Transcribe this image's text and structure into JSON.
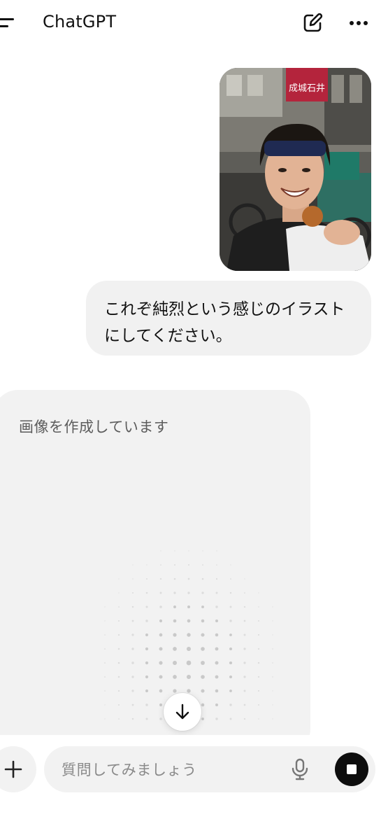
{
  "header": {
    "title": "ChatGPT",
    "menu_icon": "menu-icon",
    "compose_icon": "new-chat-icon",
    "more_icon": "more-horizontal-icon"
  },
  "conversation": {
    "user_image": {
      "alt": "photo",
      "sign_text": "成城石井"
    },
    "user_message": {
      "lines": [
        "これぞ純烈という感じのイラスト",
        "にしてください。"
      ]
    },
    "assistant": {
      "status": "画像を作成しています"
    }
  },
  "scroll_down": {
    "icon": "arrow-down-icon"
  },
  "composer": {
    "placeholder": "質問してみましょう",
    "plus_icon": "plus-icon",
    "mic_icon": "microphone-icon",
    "stop_icon": "stop-icon"
  },
  "colors": {
    "bubble": "#f1f1f1",
    "card": "#f2f2f2",
    "stop_button": "#0d0d0d",
    "placeholder": "#8a8a8a"
  }
}
